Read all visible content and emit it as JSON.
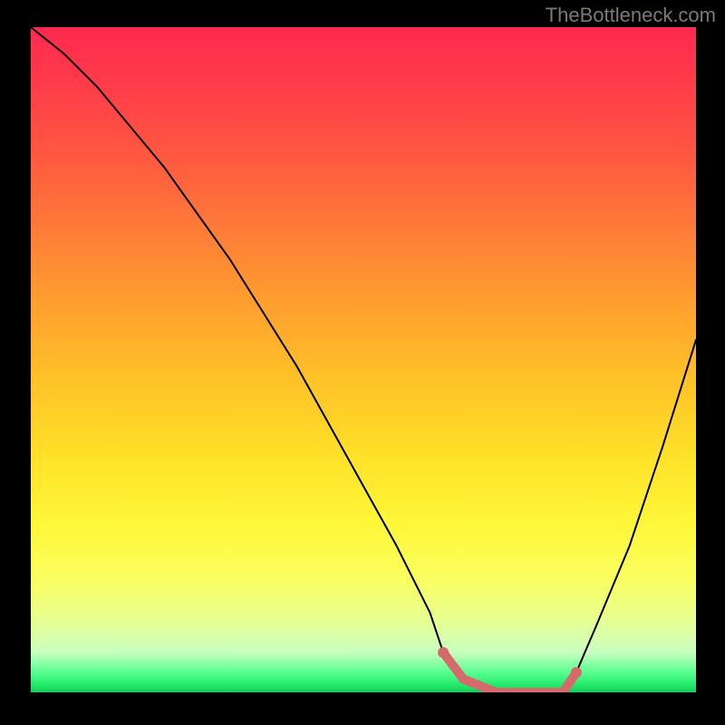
{
  "watermark": "TheBottleneck.com",
  "chart_data": {
    "type": "line",
    "title": "",
    "xlabel": "",
    "ylabel": "",
    "xlim": [
      0,
      100
    ],
    "ylim": [
      0,
      100
    ],
    "series": [
      {
        "name": "bottleneck-curve",
        "x": [
          0,
          5,
          10,
          15,
          20,
          25,
          30,
          35,
          40,
          45,
          50,
          55,
          60,
          62,
          65,
          70,
          75,
          80,
          82,
          85,
          90,
          95,
          100
        ],
        "y": [
          100,
          96,
          91,
          85,
          79,
          72,
          65,
          57,
          49,
          40,
          31,
          22,
          12,
          6,
          2,
          0,
          0,
          0,
          3,
          10,
          22,
          37,
          53
        ]
      }
    ],
    "highlight_region": {
      "name": "optimal-range",
      "x_start": 62,
      "x_end": 82,
      "color": "#d66a6a"
    },
    "gradient_stops": [
      {
        "pos": 0,
        "color": "#ff2a4f"
      },
      {
        "pos": 20,
        "color": "#ff5a40"
      },
      {
        "pos": 40,
        "color": "#ff9a30"
      },
      {
        "pos": 60,
        "color": "#ffe028"
      },
      {
        "pos": 80,
        "color": "#f8ff60"
      },
      {
        "pos": 95,
        "color": "#a0ffb0"
      },
      {
        "pos": 100,
        "color": "#18c858"
      }
    ]
  }
}
